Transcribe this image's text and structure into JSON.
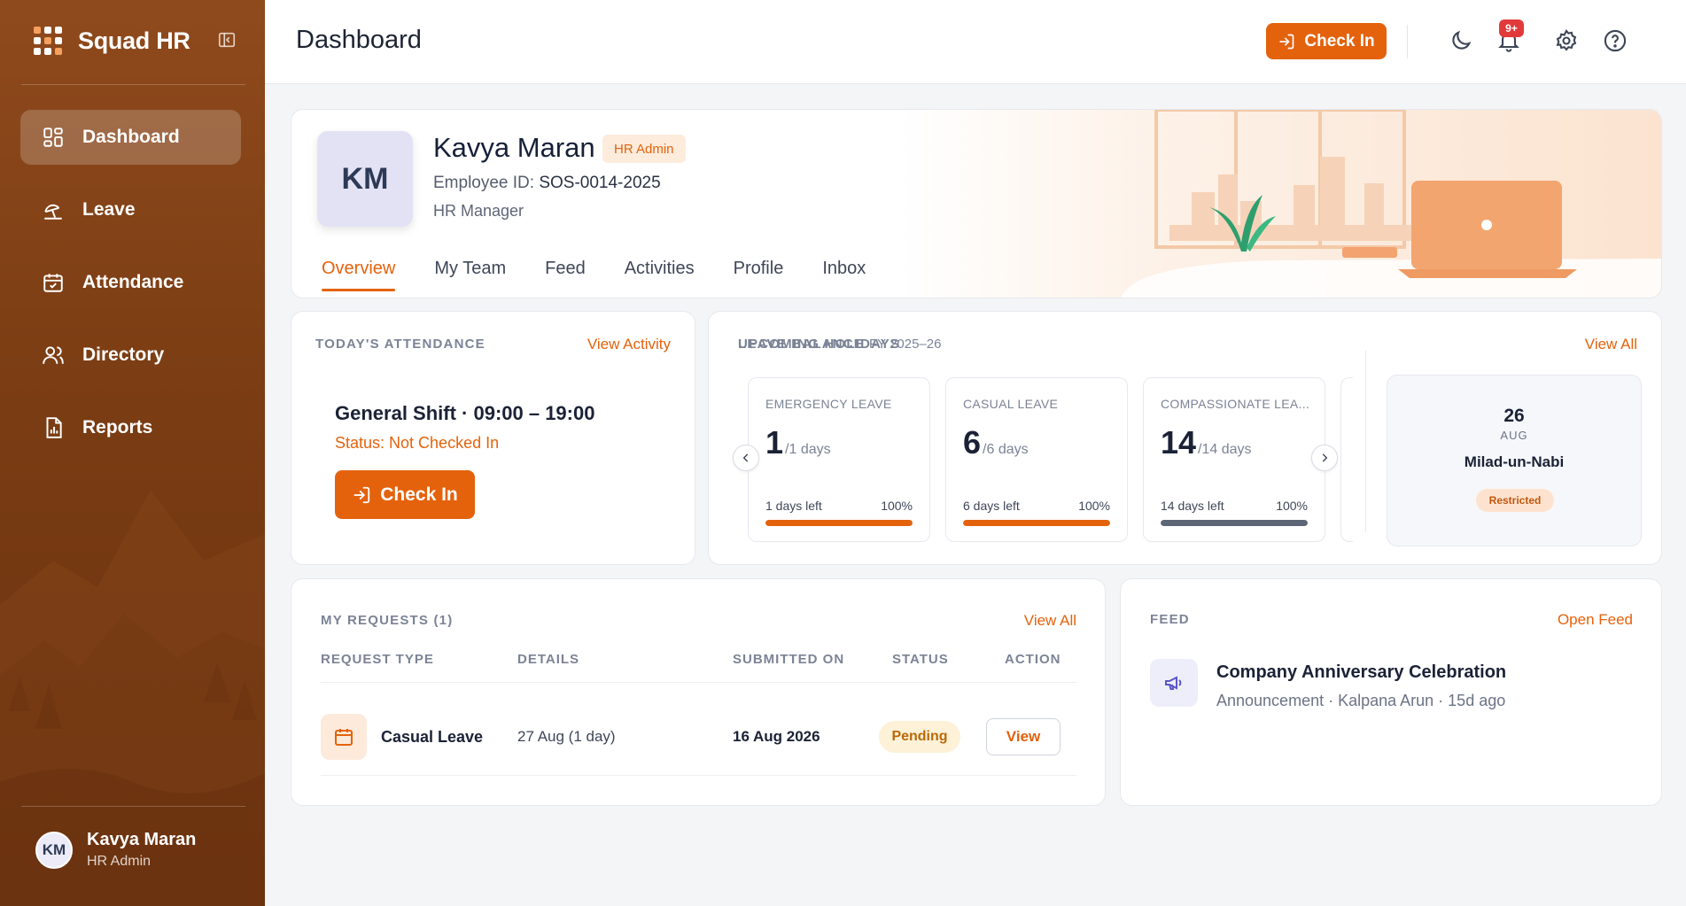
{
  "app": {
    "name": "Squad HR"
  },
  "colors": {
    "accent": "#e4620c",
    "sidebar": "#7a3c13",
    "pending": "#b86a07"
  },
  "sidebar": {
    "items": [
      {
        "label": "Dashboard",
        "icon": "dashboard-icon",
        "active": true
      },
      {
        "label": "Leave",
        "icon": "beach-icon"
      },
      {
        "label": "Attendance",
        "icon": "calendar-icon"
      },
      {
        "label": "Directory",
        "icon": "users-icon"
      },
      {
        "label": "Reports",
        "icon": "report-icon"
      }
    ],
    "user": {
      "initials": "KM",
      "name": "Kavya Maran",
      "role": "HR Admin"
    }
  },
  "header": {
    "title": "Dashboard",
    "checkin_label": "Check In",
    "notification_badge": "9+"
  },
  "profile": {
    "initials": "KM",
    "name": "Kavya Maran",
    "role_chip": "HR Admin",
    "employee_id_label": "Employee ID:",
    "employee_id": "SOS-0014-2025",
    "title": "HR Manager",
    "tabs": [
      "Overview",
      "My Team",
      "Feed",
      "Activities",
      "Profile",
      "Inbox"
    ],
    "active_tab": "Overview"
  },
  "attendance": {
    "label": "Today's Attendance",
    "link": "View Activity",
    "shift": "General Shift · 09:00 – 19:00",
    "status": "Status: Not Checked In",
    "checkin_label": "Check In"
  },
  "leave_balance": {
    "label": "Leave Balance",
    "fy": "FY 2025–26",
    "cards": [
      {
        "title": "EMERGENCY LEAVE",
        "value": "1",
        "total": "/1 days",
        "left": "1 days left",
        "pct": "100%",
        "fill": 1.0,
        "color": "#e4620c"
      },
      {
        "title": "CASUAL LEAVE",
        "value": "6",
        "total": "/6 days",
        "left": "6 days left",
        "pct": "100%",
        "fill": 1.0,
        "color": "#e4620c"
      },
      {
        "title": "COMPASSIONATE LEA...",
        "value": "14",
        "total": "/14 days",
        "left": "14 days left",
        "pct": "100%",
        "fill": 1.0,
        "color": "#5d6677"
      }
    ]
  },
  "holidays": {
    "label": "Upcoming Holidays",
    "link": "View All",
    "item": {
      "day": "26",
      "month": "AUG",
      "name": "Milad-un-Nabi",
      "tag": "Restricted"
    }
  },
  "requests": {
    "label": "My Requests (1)",
    "link": "View All",
    "columns": [
      "Request Type",
      "Details",
      "Submitted On",
      "Status",
      "Action"
    ],
    "rows": [
      {
        "type": "Casual Leave",
        "details": "27 Aug (1 day)",
        "submitted": "16 Aug 2026",
        "status": "Pending",
        "action": "View"
      }
    ]
  },
  "feed": {
    "label": "Feed",
    "link": "Open Feed",
    "item": {
      "title": "Company Anniversary Celebration",
      "meta": "Announcement · Kalpana Arun · 15d ago"
    }
  }
}
